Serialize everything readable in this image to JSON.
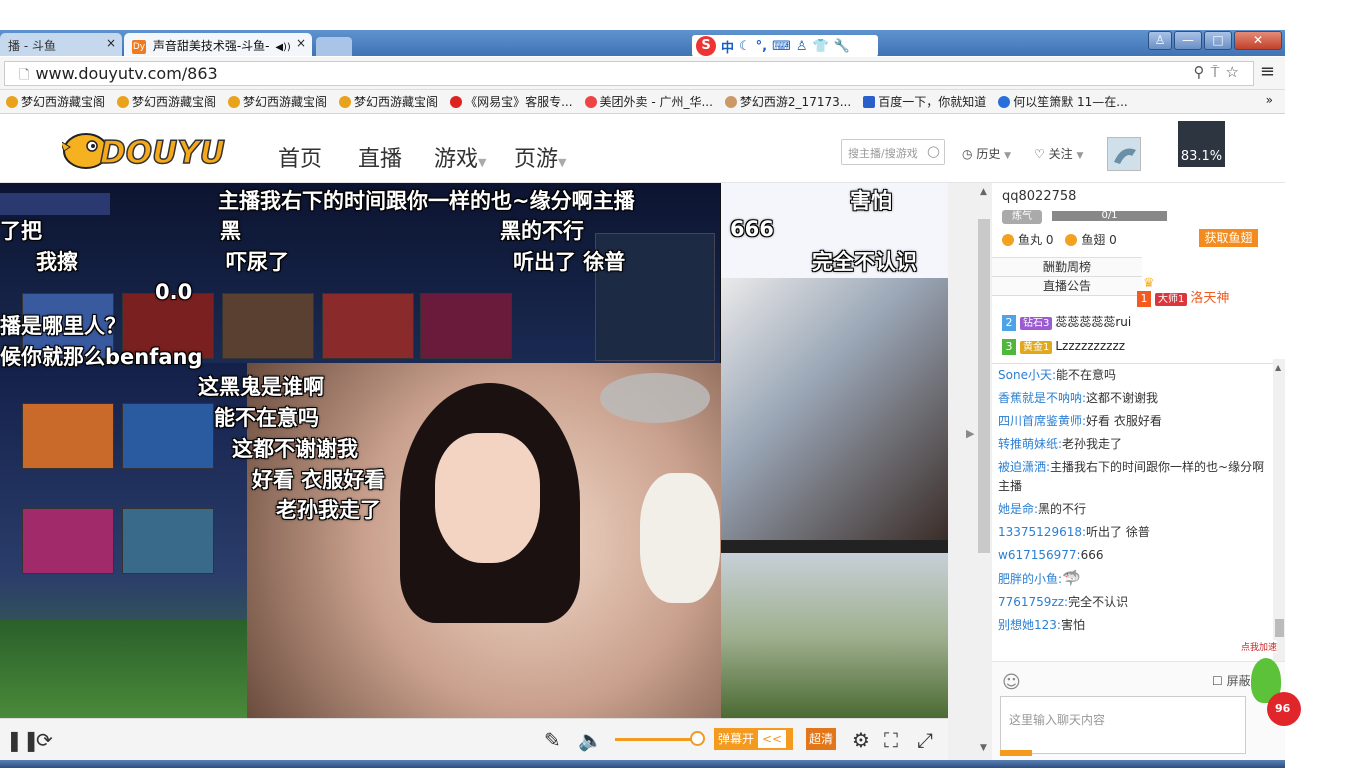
{
  "browser": {
    "tabs": [
      {
        "label": "播 - 斗鱼",
        "active": false
      },
      {
        "label": "声音甜美技术强-斗鱼-",
        "active": true
      }
    ],
    "tab_close": "×",
    "url": "www.douyutv.com/863",
    "ime": {
      "label": "中"
    },
    "window_controls": {
      "minimize": "—",
      "maximize": "□",
      "close": "✕"
    },
    "bookmarks": [
      "梦幻西游藏宝阁",
      "梦幻西游藏宝阁",
      "梦幻西游藏宝阁",
      "梦幻西游藏宝阁",
      "《网易宝》客服专...",
      "美团外卖 - 广州_华...",
      "梦幻西游2_17173...",
      "百度一下，你就知道",
      "何以笙箫默 11—在..."
    ],
    "bookmarks_more": "»"
  },
  "site": {
    "logo": "DOUYU",
    "nav": [
      "首页",
      "直播",
      "游戏",
      "页游"
    ],
    "search_placeholder": "搜主播/搜游戏",
    "history": "历史",
    "follow": "关注",
    "cpu": "83.1%"
  },
  "video": {
    "danmaku": [
      "主播我右下的时间跟你一样的也~缘分啊主播",
      "黑",
      "黑的不行",
      "害怕",
      "了把",
      "666",
      "我擦",
      "吓尿了",
      "听出了  徐普",
      "完全不认识",
      "0.0",
      "播是哪里人？",
      "候你就那么benfang",
      "这黑鬼是谁啊",
      "能不在意吗",
      "这都不谢谢我",
      "好看  衣服好看",
      "老孙我走了"
    ]
  },
  "player": {
    "danmaku_toggle": "弹幕开",
    "danmaku_arrow": "<<",
    "quality": "超清"
  },
  "chat": {
    "username": "qq8022758",
    "level_badge": "炼气",
    "level_progress": "0/1",
    "fishball_label": "鱼丸",
    "fishball_count": "0",
    "fishfin_label": "鱼翅",
    "fishfin_count": "0",
    "get_fish_button": "获取鱼翅",
    "tabs": [
      "酬勤周榜",
      "直播公告"
    ],
    "ranking": [
      {
        "rank": "1",
        "badge": "大师1",
        "name": "洛天神",
        "color": "#f25a1f"
      },
      {
        "rank": "2",
        "badge": "钻石3",
        "name": "蕊蕊蕊蕊蕊rui",
        "color": "#4da3e6"
      },
      {
        "rank": "3",
        "badge": "黄金1",
        "name": "Lzzzzzzzzzz",
        "color": "#4fb83c"
      }
    ],
    "messages": [
      {
        "name": "Sone小天:",
        "text": "能不在意吗"
      },
      {
        "name": "香蕉就是不呐呐:",
        "text": "这都不谢谢我"
      },
      {
        "name": "四川首席鉴黄师:",
        "text": "好看 衣服好看"
      },
      {
        "name": "转推萌妹纸:",
        "text": "老孙我走了"
      },
      {
        "name": "被迫潇洒:",
        "text": "主播我右下的时间跟你一样的也~缘分啊主播"
      },
      {
        "name": "她是命:",
        "text": "黑的不行"
      },
      {
        "name": "13375129618:",
        "text": "听出了 徐普"
      },
      {
        "name": "w617156977:",
        "text": "666"
      },
      {
        "name": "肥胖的小鱼:",
        "text": ""
      },
      {
        "name": "7761759zz:",
        "text": "完全不认识"
      },
      {
        "name": "别想她123:",
        "text": "害怕"
      }
    ],
    "block_label": "屏蔽",
    "input_placeholder": "这里输入聊天内容",
    "floater_label": "点我加速",
    "floater_badge": "96"
  }
}
